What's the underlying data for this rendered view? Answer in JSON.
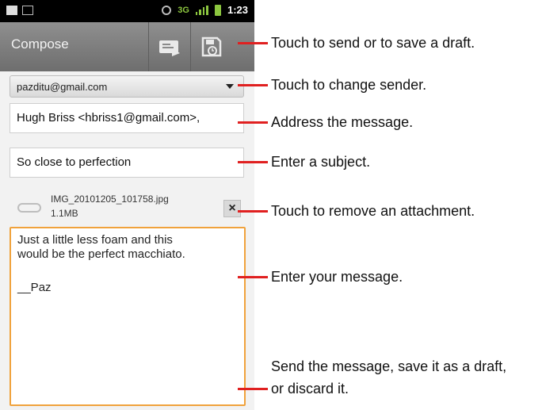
{
  "statusbar": {
    "time": "1:23"
  },
  "toolbar": {
    "title": "Compose",
    "send_icon": "send-icon",
    "save_icon": "save-draft-icon"
  },
  "compose": {
    "sender": "pazditu@gmail.com",
    "to": "Hugh Briss <hbriss1@gmail.com>,",
    "subject": "So close to perfection",
    "attachment": {
      "name": "IMG_20101205_101758.jpg",
      "size": "1.1MB"
    },
    "body_lines": [
      "Just a little less foam and this",
      "would be the perfect macchiato.",
      "__Paz"
    ]
  },
  "callouts": {
    "send_or_save": "Touch to send or to save a draft.",
    "change_sender": "Touch to change sender.",
    "address": "Address the message.",
    "subject": "Enter a subject.",
    "remove_attachment": "Touch to remove an attachment.",
    "message": "Enter your message.",
    "send_line1": "Send the message, save it as a draft,",
    "send_line2": "or discard it."
  },
  "colors": {
    "accent_orange": "#f0a23c",
    "callout_red": "#e02020",
    "status_green": "#8cc63f"
  }
}
